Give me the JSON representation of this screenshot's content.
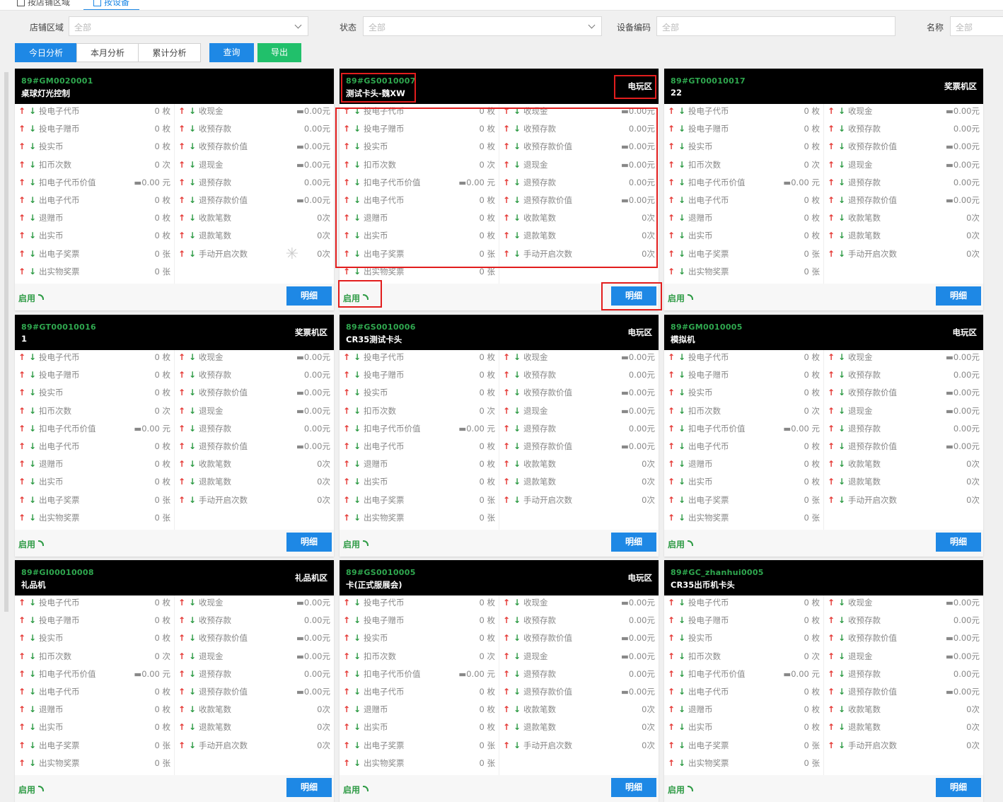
{
  "tabs": [
    {
      "label": "按店铺区域"
    },
    {
      "label": "按设备"
    }
  ],
  "filters": {
    "region": {
      "label": "店铺区域",
      "placeholder": "全部"
    },
    "status": {
      "label": "状态",
      "placeholder": "全部"
    },
    "device_code": {
      "label": "设备编码",
      "placeholder": "全部"
    },
    "name": {
      "label": "名称",
      "placeholder": "全部"
    }
  },
  "periods": [
    "今日分析",
    "本月分析",
    "累计分析"
  ],
  "actions": {
    "query": "查询",
    "export": "导出"
  },
  "left_metrics": [
    "投电子代币",
    "投电子赠币",
    "投实币",
    "扣币次数",
    "扣电子代币价值",
    "出电子代币",
    "退赠币",
    "出实币",
    "出电子奖票",
    "出实物奖票"
  ],
  "left_values": [
    "0 枚",
    "0 枚",
    "0 枚",
    "0 次",
    "▬0.00 元",
    "0 枚",
    "0 枚",
    "0 枚",
    "0 张",
    "0 张"
  ],
  "right_metrics": [
    "收现金",
    "收预存款",
    "收预存款价值",
    "退现金",
    "退预存款",
    "退预存款价值",
    "收款笔数",
    "退款笔数",
    "手动开启次数"
  ],
  "right_values": [
    "▬0.00元",
    "0.00元",
    "▬0.00元",
    "▬0.00元",
    "0.00元",
    "▬0.00元",
    "0次",
    "0次",
    "0次"
  ],
  "status_label": "启用",
  "detail_label": "明细",
  "devices": [
    {
      "code": "89#GM0020001",
      "name": "桌球灯光控制",
      "zone": ""
    },
    {
      "code": "89#GS0010007",
      "name": "测试卡头-魏XW",
      "zone": "电玩区"
    },
    {
      "code": "89#GT00010017",
      "name": "22",
      "zone": "奖票机区"
    },
    {
      "code": "89#GT00010016",
      "name": "1",
      "zone": "奖票机区"
    },
    {
      "code": "89#GS0010006",
      "name": "CR35测试卡头",
      "zone": "电玩区"
    },
    {
      "code": "89#GM0010005",
      "name": "模拟机",
      "zone": "电玩区"
    },
    {
      "code": "89#GI00010008",
      "name": "礼品机",
      "zone": "礼品机区"
    },
    {
      "code": "89#GS0010005",
      "name": "卡(正式服展会)",
      "zone": "电玩区"
    },
    {
      "code": "89#GC_zhanhui0005",
      "name": "CR35出币机卡头",
      "zone": ""
    }
  ]
}
